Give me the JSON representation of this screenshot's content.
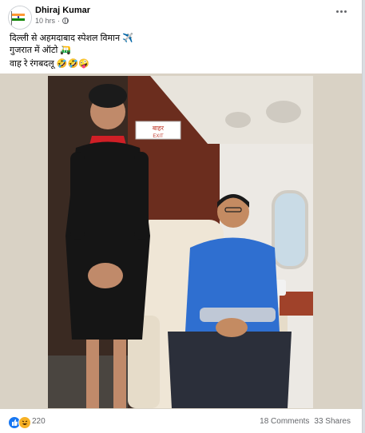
{
  "post": {
    "author": "Dhiraj Kumar",
    "time": "10 hrs",
    "dot": "·",
    "line1": "दिल्ली से अहमदाबाद स्पेशल विमान ✈️",
    "line2": "गुजरात में ऑटो 🛺",
    "line3": "वाह रे रंगबदलू 🤣🤣🤪"
  },
  "image": {
    "exit_sign": "बाहर",
    "exit_sign_en": "EXIT"
  },
  "footer": {
    "reaction_count": "220",
    "comments": "18 Comments",
    "shares": "33 Shares"
  },
  "colors": {
    "accent": "#1877f2",
    "muted": "#65676b",
    "text": "#050505"
  }
}
